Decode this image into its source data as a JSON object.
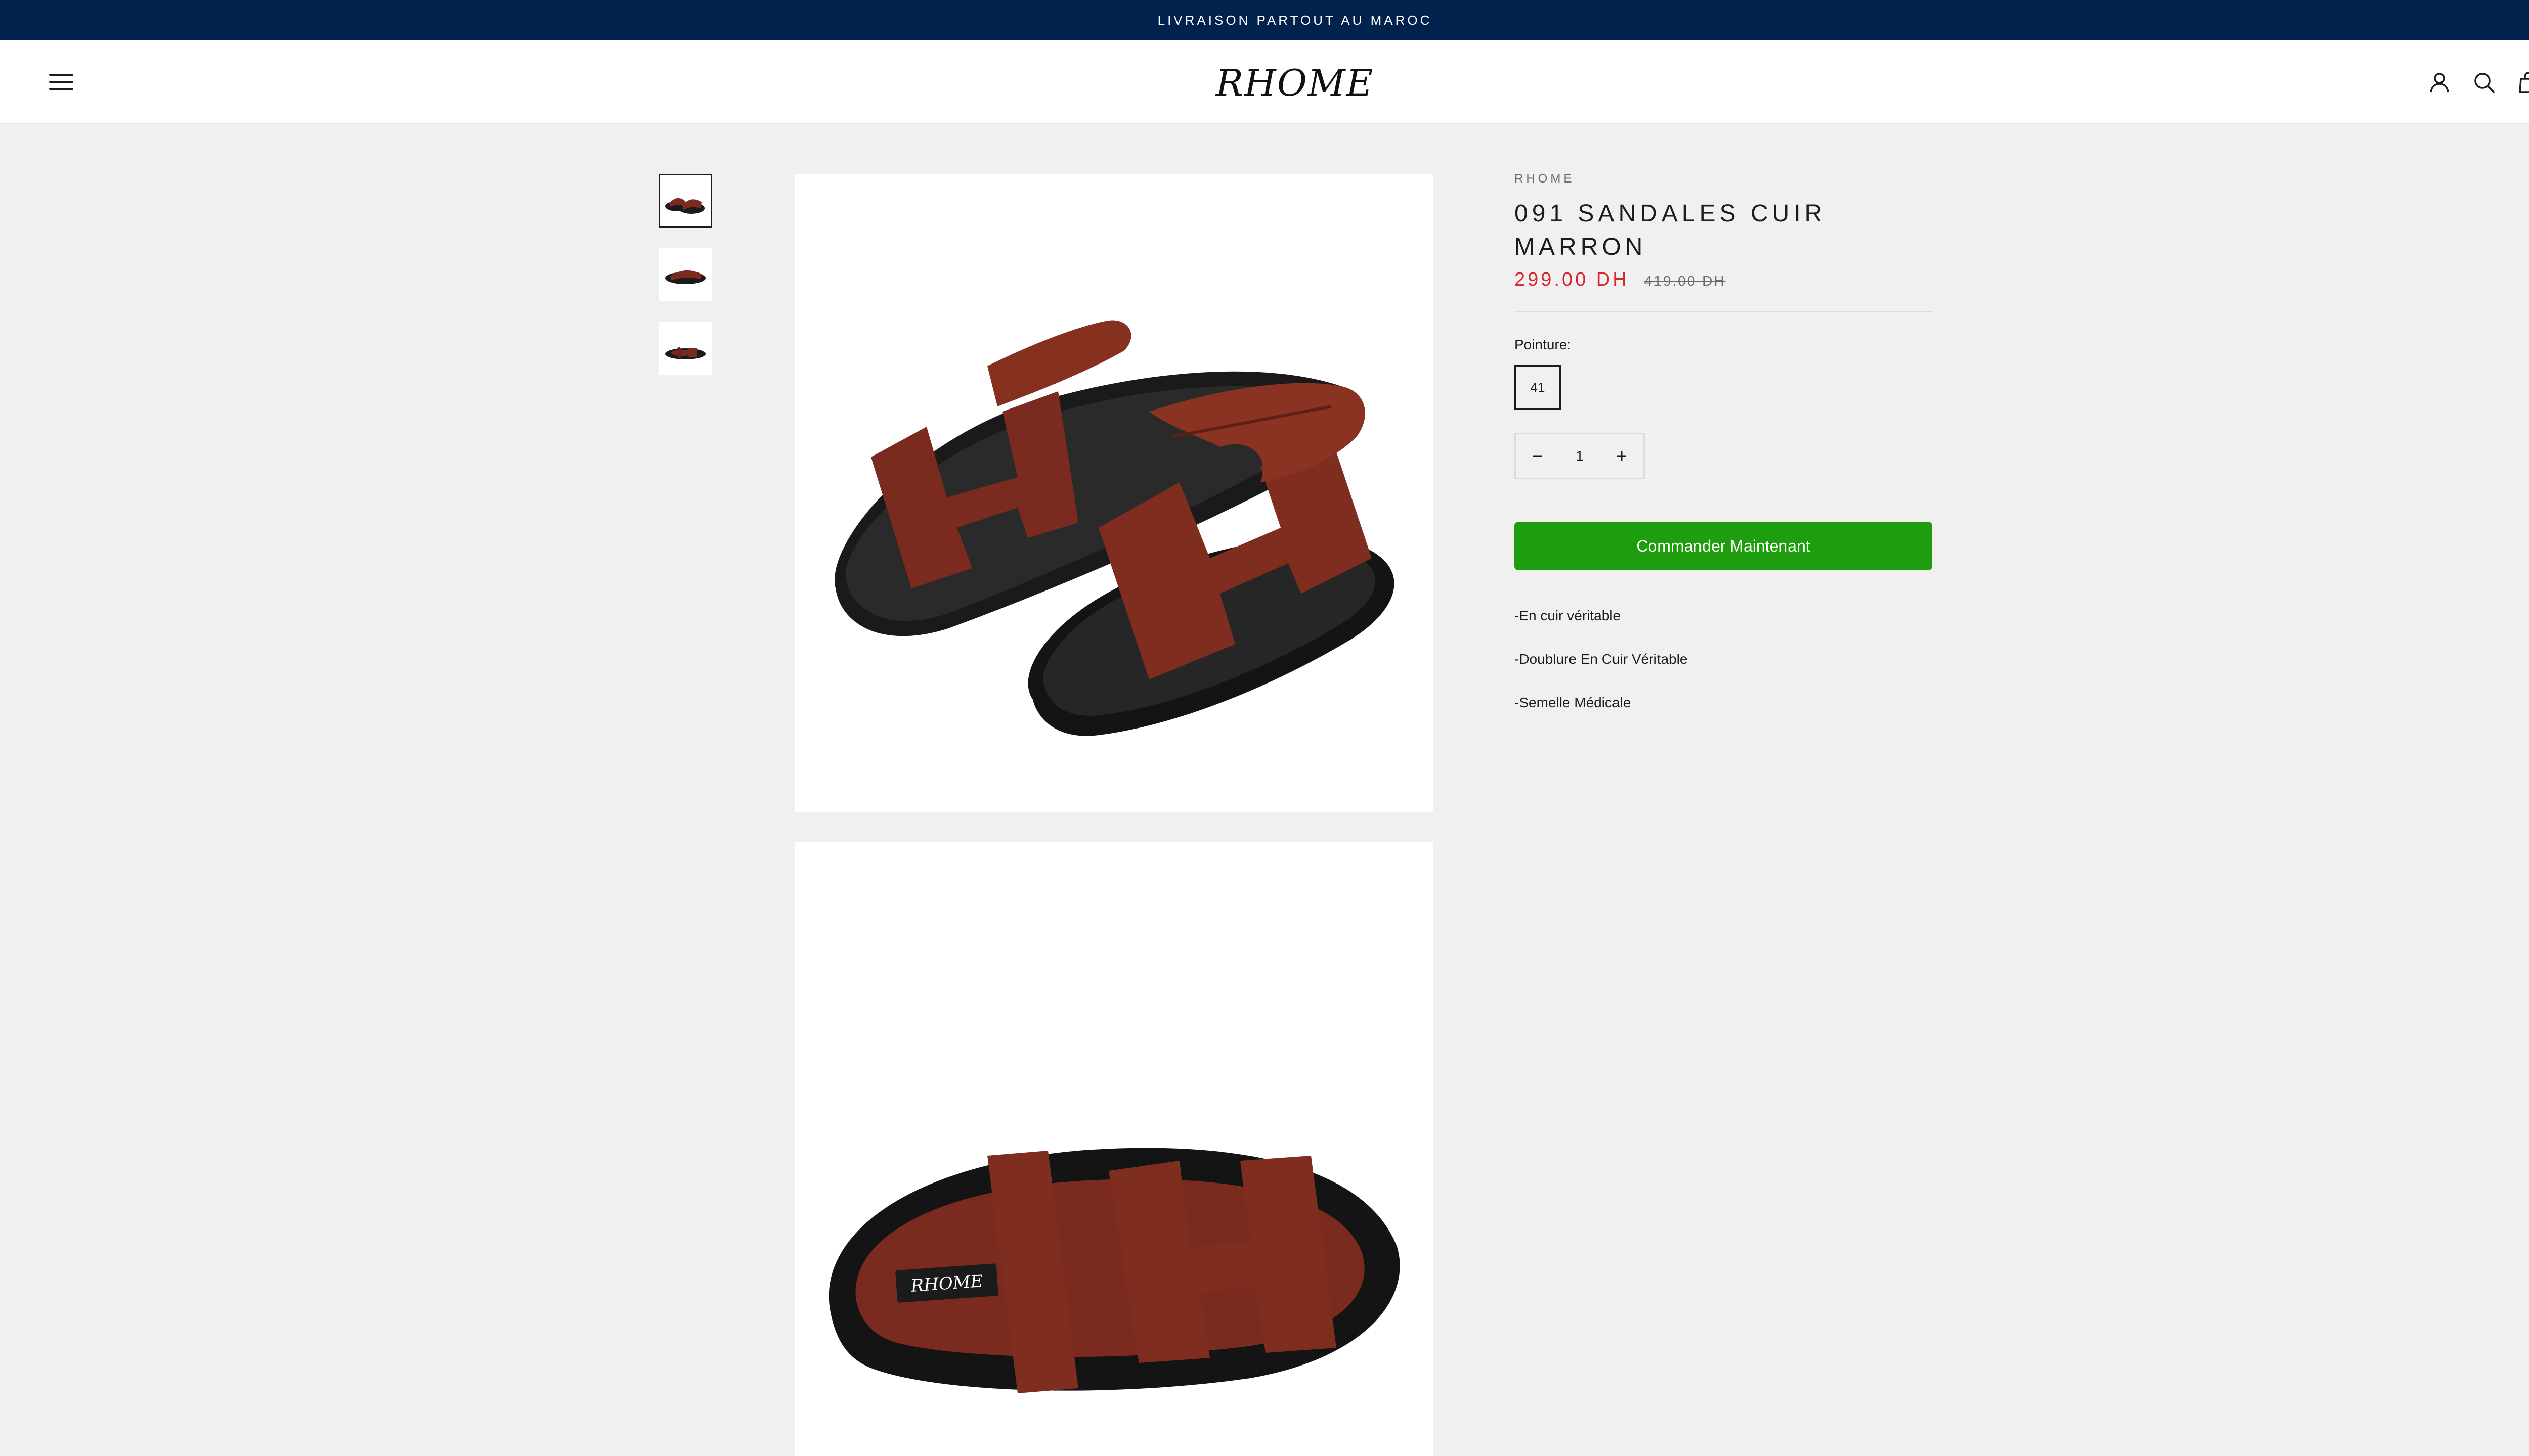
{
  "announcement": {
    "text": "LIVRAISON PARTOUT AU MAROC"
  },
  "header": {
    "logo_text": "RHOME",
    "icons": [
      "menu-icon",
      "account-icon",
      "search-icon",
      "cart-icon"
    ]
  },
  "gallery": {
    "thumbnails": [
      "sandal-pair-thumbnail",
      "sandal-side-thumbnail",
      "sandal-top-thumbnail"
    ],
    "images": [
      "sandal-pair-image",
      "sandal-side-image"
    ]
  },
  "product": {
    "vendor": "RHOME",
    "title": "091 SANDALES CUIR MARRON",
    "price": "299.00 DH",
    "compare_price": "419.00 DH",
    "option_label": "Pointure:",
    "selected_size": "41",
    "quantity": "1",
    "cta_label": "Commander Maintenant",
    "description": [
      "-En cuir véritable",
      "-Doublure En Cuir Véritable",
      "-Semelle Médicale"
    ],
    "insole_logo": "RHOME"
  },
  "colors": {
    "announcement_bg": "#01224c",
    "price_sale": "#d9242b",
    "cta_bg": "#1e9e0e",
    "page_bg": "#f0f0f0",
    "leather": "#7a2a1e"
  }
}
